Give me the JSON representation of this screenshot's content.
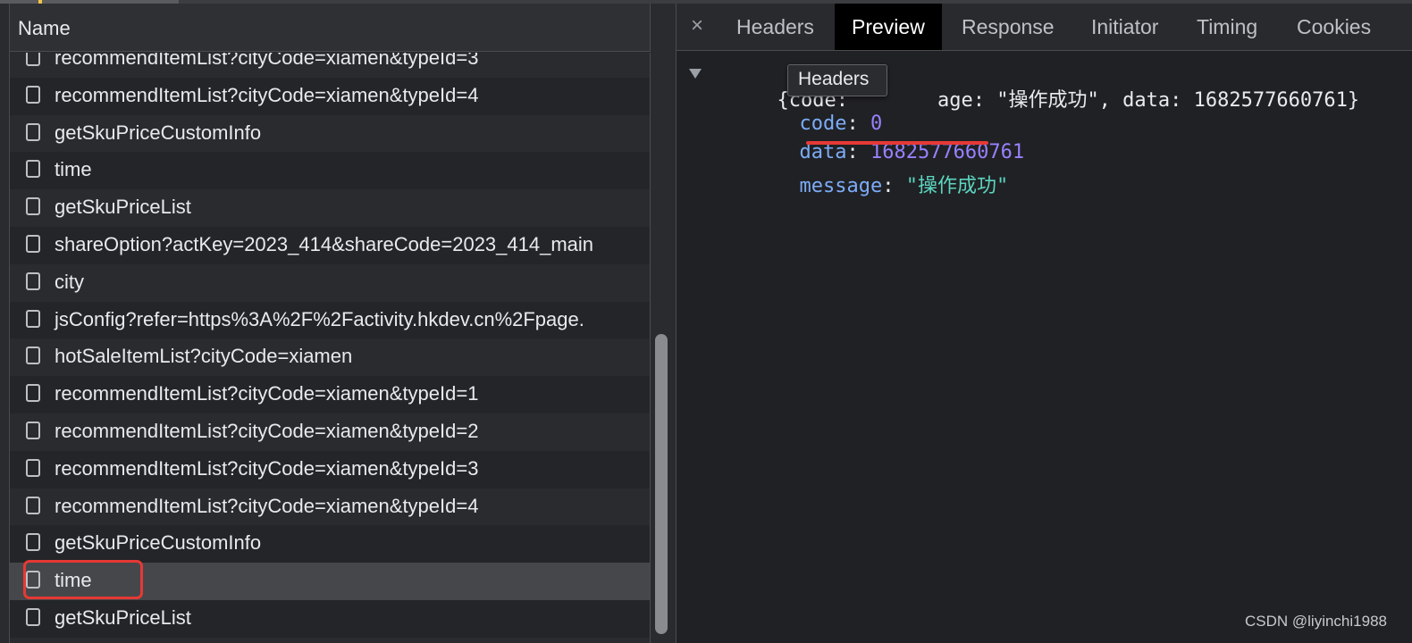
{
  "network_list": {
    "header": "Name",
    "rows": [
      {
        "label": "recommendItemList?cityCode=xiamen&typeId=3",
        "selected": false
      },
      {
        "label": "recommendItemList?cityCode=xiamen&typeId=4",
        "selected": false
      },
      {
        "label": "getSkuPriceCustomInfo",
        "selected": false
      },
      {
        "label": "time",
        "selected": false
      },
      {
        "label": "getSkuPriceList",
        "selected": false
      },
      {
        "label": "shareOption?actKey=2023_414&shareCode=2023_414_main",
        "selected": false
      },
      {
        "label": "city",
        "selected": false
      },
      {
        "label": "jsConfig?refer=https%3A%2F%2Factivity.hkdev.cn%2Fpage.",
        "selected": false
      },
      {
        "label": "hotSaleItemList?cityCode=xiamen",
        "selected": false
      },
      {
        "label": "recommendItemList?cityCode=xiamen&typeId=1",
        "selected": false
      },
      {
        "label": "recommendItemList?cityCode=xiamen&typeId=2",
        "selected": false
      },
      {
        "label": "recommendItemList?cityCode=xiamen&typeId=3",
        "selected": false
      },
      {
        "label": "recommendItemList?cityCode=xiamen&typeId=4",
        "selected": false
      },
      {
        "label": "getSkuPriceCustomInfo",
        "selected": false
      },
      {
        "label": "time",
        "selected": true
      },
      {
        "label": "getSkuPriceList",
        "selected": false
      }
    ]
  },
  "tabs": {
    "close": "×",
    "headers": "Headers",
    "preview": "Preview",
    "response": "Response",
    "initiator": "Initiator",
    "timing": "Timing",
    "cookies": "Cookies"
  },
  "preview": {
    "summary_open": "{code:",
    "summary_rest": "age: \"操作成功\", data: 1682577660761}",
    "code_key": "code",
    "code_value": "0",
    "data_key": "data",
    "data_value": "1682577660761",
    "message_key": "message",
    "message_value": "\"操作成功\""
  },
  "tooltip": "Headers",
  "watermark": "CSDN @liyinchi1988",
  "colors": {
    "accent_red": "#e53935",
    "number": "#9980ff",
    "string": "#5cd5c0",
    "key": "#7cacf8"
  }
}
